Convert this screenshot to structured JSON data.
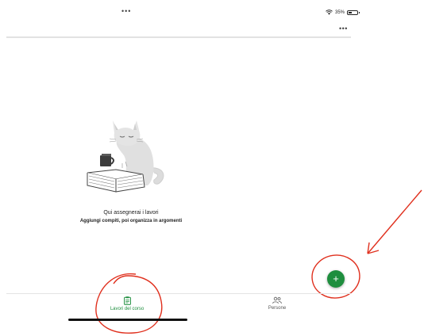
{
  "status_bar": {
    "center_dots": "•••",
    "battery_percent": "35%"
  },
  "header": {
    "more_menu": "•••"
  },
  "empty_state": {
    "title": "Qui assegnerai i lavori",
    "subtitle": "Aggiungi compiti, poi organizza in argomenti"
  },
  "fab": {
    "symbol": "+",
    "color": "#1e8e3e"
  },
  "bottom_nav": {
    "items": [
      {
        "label": "Lavori del corso",
        "icon": "assignment-icon",
        "active": true
      },
      {
        "label": "Persone",
        "icon": "people-icon",
        "active": false
      }
    ]
  },
  "annotations": {
    "color": "#e0301e"
  }
}
